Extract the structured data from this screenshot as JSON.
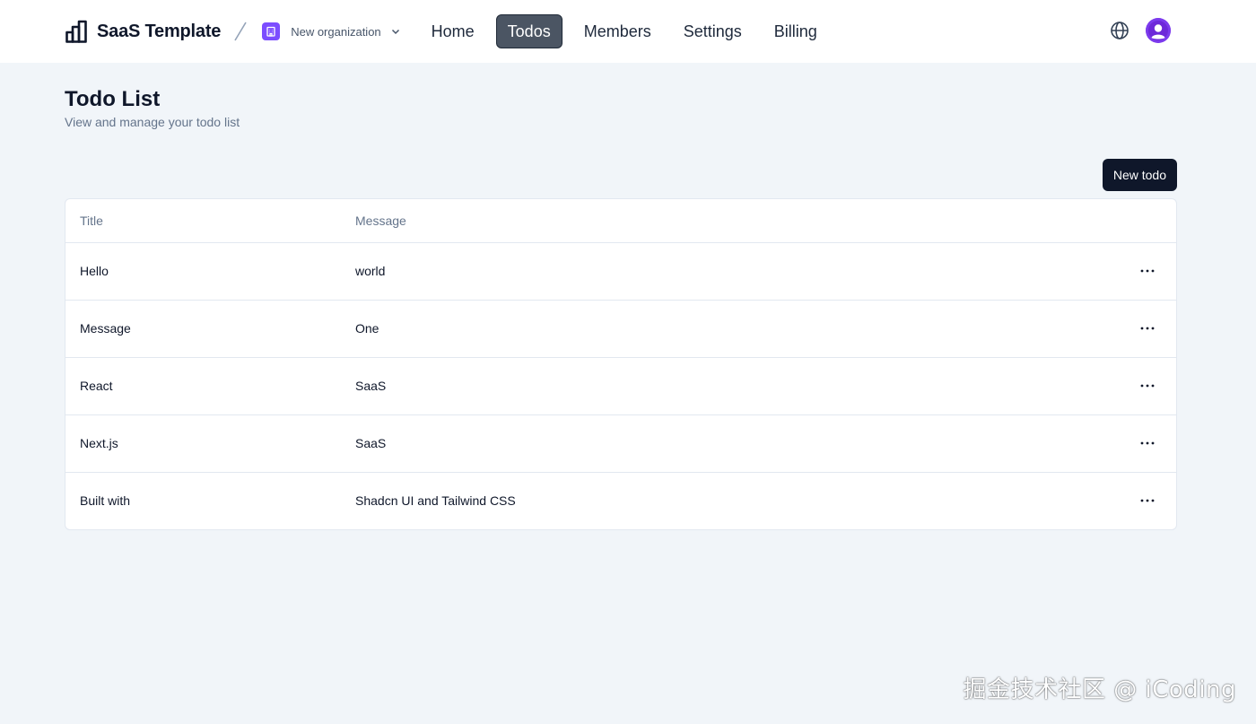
{
  "brand": {
    "name": "SaaS Template"
  },
  "org": {
    "name": "New organization"
  },
  "nav": [
    {
      "label": "Home",
      "active": false
    },
    {
      "label": "Todos",
      "active": true
    },
    {
      "label": "Members",
      "active": false
    },
    {
      "label": "Settings",
      "active": false
    },
    {
      "label": "Billing",
      "active": false
    }
  ],
  "icons": {
    "brand": "bar-chart-icon",
    "separator": "slash-icon",
    "org": "building-icon",
    "chevron": "chevron-down-icon",
    "language": "globe-icon",
    "user": "user-avatar-icon",
    "row_actions": "more-horizontal-icon"
  },
  "colors": {
    "background": "#f1f5f9",
    "primary": "#0f172a",
    "active_nav": "#4b5563",
    "org_avatar": "#7c4dff",
    "user_avatar": "#7c3aed"
  },
  "page": {
    "title": "Todo List",
    "subtitle": "View and manage your todo list",
    "new_button": "New todo"
  },
  "table": {
    "columns": [
      "Title",
      "Message"
    ],
    "rows": [
      {
        "title": "Hello",
        "message": "world"
      },
      {
        "title": "Message",
        "message": "One"
      },
      {
        "title": "React",
        "message": "SaaS"
      },
      {
        "title": "Next.js",
        "message": "SaaS"
      },
      {
        "title": "Built with",
        "message": "Shadcn UI and Tailwind CSS"
      }
    ]
  },
  "watermark": "掘金技术社区 @ iCoding"
}
